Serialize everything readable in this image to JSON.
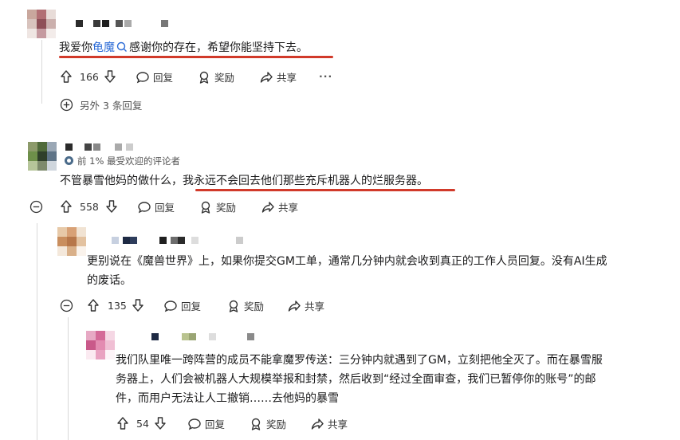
{
  "comments": [
    {
      "text_before": "我爱你",
      "link": "龟魔",
      "text_after": "感谢你的存在，希望你能坚持下去。",
      "votes": "166",
      "reply": "回复",
      "award": "奖励",
      "share": "共享",
      "more": "···",
      "more_replies": "另外 3 条回复"
    },
    {
      "badge": "前 1% 最受欢迎的评论者",
      "text_plain": "不管暴雪他妈的做什么，",
      "text_highlight": "我永远不会回去他们那些充斥机器人的烂服务器。",
      "votes": "558",
      "reply": "回复",
      "award": "奖励",
      "share": "共享"
    },
    {
      "line1": "更别说在《魔兽世界》上，如果你提交GM工单，通常几分钟内就会收到真正的工作人员回复。没有AI生成",
      "line2": "的废话。",
      "votes": "135",
      "reply": "回复",
      "award": "奖励",
      "share": "共享"
    },
    {
      "line1": "我们队里唯一跨阵营的成员不能拿魔罗传送：三分钟内就遇到了GM，立刻把他全灭了。而在暴雪服",
      "line2": "务器上，人们会被机器人大规模举报和封禁，然后收到“经过全面审查，我们已暂停你的账号”的邮",
      "line3": "件，而用户无法让人工撤销……去他妈的暴雪",
      "votes": "54",
      "reply": "回复",
      "award": "奖励",
      "share": "共享"
    }
  ],
  "colors": {
    "underline": "#d13a2a",
    "link": "#2a6ad6",
    "thread": "#d9d9d9"
  }
}
